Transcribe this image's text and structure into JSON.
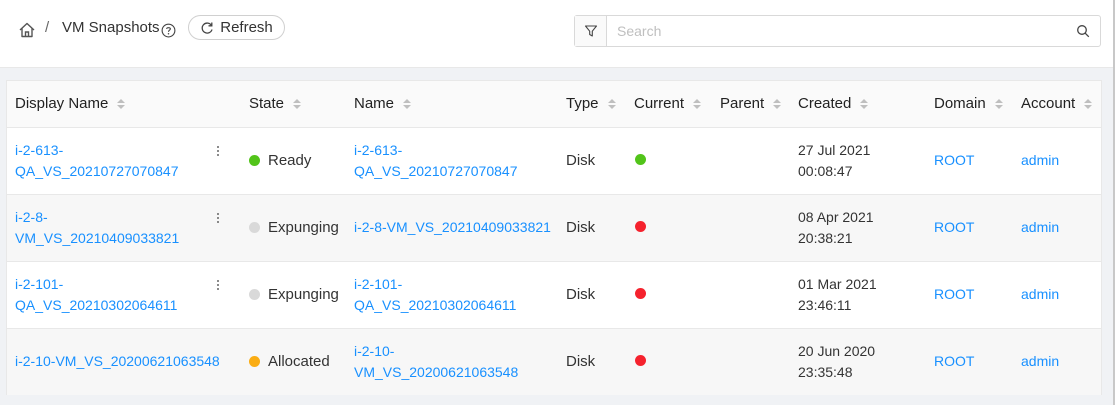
{
  "breadcrumb": {
    "separator": "/",
    "title": "VM Snapshots"
  },
  "toolbar": {
    "refresh_label": "Refresh"
  },
  "search": {
    "placeholder": "Search",
    "value": ""
  },
  "colors": {
    "link": "#1890ff",
    "green": "#52c41a",
    "red": "#f5222d",
    "orange": "#faad14",
    "grey": "#d9d9d9"
  },
  "columns": [
    "Display Name",
    "State",
    "Name",
    "Type",
    "Current",
    "Parent",
    "Created",
    "Domain",
    "Account"
  ],
  "rows": [
    {
      "display_name_1": "i-2-613-",
      "display_name_2": "QA_VS_20210727070847",
      "state": "Ready",
      "state_color": "#52c41a",
      "name_1": "i-2-613-",
      "name_2": "QA_VS_20210727070847",
      "type": "Disk",
      "current_color": "#52c41a",
      "parent": "",
      "created_1": "27 Jul 2021",
      "created_2": "00:08:47",
      "domain": "ROOT",
      "account": "admin"
    },
    {
      "display_name_1": "i-2-8-",
      "display_name_2": "VM_VS_20210409033821",
      "state": "Expunging",
      "state_color": "#d9d9d9",
      "name_1": "i-2-8-VM_VS_20210409033821",
      "name_2": "",
      "type": "Disk",
      "current_color": "#f5222d",
      "parent": "",
      "created_1": "08 Apr 2021",
      "created_2": "20:38:21",
      "domain": "ROOT",
      "account": "admin"
    },
    {
      "display_name_1": "i-2-101-",
      "display_name_2": "QA_VS_20210302064611",
      "state": "Expunging",
      "state_color": "#d9d9d9",
      "name_1": "i-2-101-",
      "name_2": "QA_VS_20210302064611",
      "type": "Disk",
      "current_color": "#f5222d",
      "parent": "",
      "created_1": "01 Mar 2021",
      "created_2": "23:46:11",
      "domain": "ROOT",
      "account": "admin"
    },
    {
      "display_name_1": "i-2-10-VM_VS_20200621063548",
      "display_name_2": "",
      "state": "Allocated",
      "state_color": "#faad14",
      "name_1": "i-2-10-",
      "name_2": "VM_VS_20200621063548",
      "type": "Disk",
      "current_color": "#f5222d",
      "parent": "",
      "created_1": "20 Jun 2020",
      "created_2": "23:35:48",
      "domain": "ROOT",
      "account": "admin"
    }
  ]
}
